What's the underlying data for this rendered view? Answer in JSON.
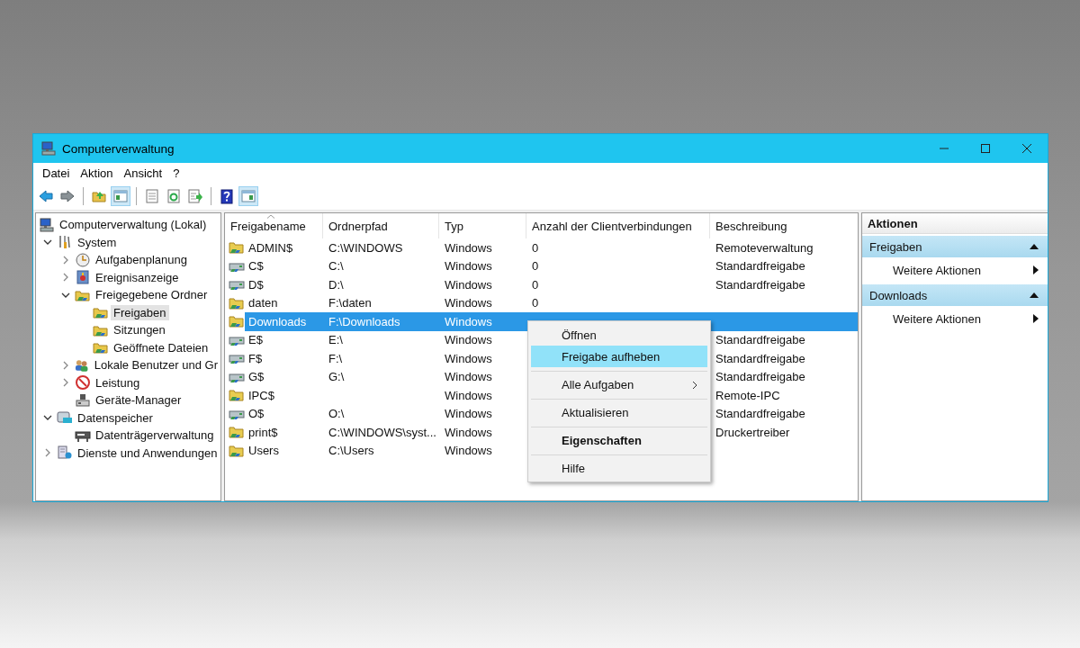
{
  "window": {
    "title": "Computerverwaltung"
  },
  "menu_bar": [
    "Datei",
    "Aktion",
    "Ansicht",
    "?"
  ],
  "toolbar": [
    {
      "kind": "back",
      "pressed": false
    },
    {
      "kind": "forward",
      "pressed": false
    },
    {
      "kind": "separator"
    },
    {
      "kind": "folder-up",
      "pressed": false
    },
    {
      "kind": "tree-pane",
      "pressed": true
    },
    {
      "kind": "separator"
    },
    {
      "kind": "properties",
      "pressed": false
    },
    {
      "kind": "refresh",
      "pressed": false
    },
    {
      "kind": "export",
      "pressed": false
    },
    {
      "kind": "separator"
    },
    {
      "kind": "help",
      "pressed": false
    },
    {
      "kind": "action-pane",
      "pressed": true
    }
  ],
  "tree": [
    {
      "label": "Computerverwaltung (Lokal)",
      "kind": "computer",
      "selected": false,
      "children": [
        {
          "label": "System",
          "kind": "tools",
          "expanded": true,
          "selected": false,
          "children": [
            {
              "label": "Aufgabenplanung",
              "kind": "clock",
              "expanded": false,
              "selected": false
            },
            {
              "label": "Ereignisanzeige",
              "kind": "event",
              "expanded": false,
              "selected": false
            },
            {
              "label": "Freigegebene Ordner",
              "kind": "share",
              "expanded": true,
              "selected": false,
              "children": [
                {
                  "label": "Freigaben",
                  "kind": "share",
                  "selected": true
                },
                {
                  "label": "Sitzungen",
                  "kind": "share",
                  "selected": false
                },
                {
                  "label": "Geöffnete Dateien",
                  "kind": "share",
                  "selected": false
                }
              ]
            },
            {
              "label": "Lokale Benutzer und Gr",
              "kind": "users",
              "expanded": false,
              "selected": false
            },
            {
              "label": "Leistung",
              "kind": "performance",
              "expanded": false,
              "selected": false
            },
            {
              "label": "Geräte-Manager",
              "kind": "device",
              "selected": false
            }
          ]
        },
        {
          "label": "Datenspeicher",
          "kind": "storage",
          "expanded": true,
          "selected": false,
          "children": [
            {
              "label": "Datenträgerverwaltung",
              "kind": "disk",
              "selected": false
            }
          ]
        },
        {
          "label": "Dienste und Anwendungen",
          "kind": "services",
          "expanded": false,
          "selected": false
        }
      ]
    }
  ],
  "table": {
    "columns": [
      {
        "label": "Freigabename",
        "sorted": true
      },
      {
        "label": "Ordnerpfad",
        "sorted": false
      },
      {
        "label": "Typ",
        "sorted": false
      },
      {
        "label": "Anzahl der Clientverbindungen",
        "sorted": false
      },
      {
        "label": "Beschreibung",
        "sorted": false
      }
    ],
    "rows": [
      {
        "kind": "folder",
        "selected": false,
        "name": "ADMIN$",
        "path": "C:\\WINDOWS",
        "type": "Windows",
        "connections": "0",
        "description": "Remoteverwaltung"
      },
      {
        "kind": "drive",
        "selected": false,
        "name": "C$",
        "path": "C:\\",
        "type": "Windows",
        "connections": "0",
        "description": "Standardfreigabe"
      },
      {
        "kind": "drive",
        "selected": false,
        "name": "D$",
        "path": "D:\\",
        "type": "Windows",
        "connections": "0",
        "description": "Standardfreigabe"
      },
      {
        "kind": "folder",
        "selected": false,
        "name": "daten",
        "path": "F:\\daten",
        "type": "Windows",
        "connections": "0"
      },
      {
        "kind": "folder",
        "selected": true,
        "name": "Downloads",
        "path": "F:\\Downloads",
        "type": "Windows"
      },
      {
        "kind": "drive",
        "selected": false,
        "name": "E$",
        "path": "E:\\",
        "type": "Windows",
        "description": "Standardfreigabe"
      },
      {
        "kind": "drive",
        "selected": false,
        "name": "F$",
        "path": "F:\\",
        "type": "Windows",
        "description": "Standardfreigabe"
      },
      {
        "kind": "drive",
        "selected": false,
        "name": "G$",
        "path": "G:\\",
        "type": "Windows",
        "description": "Standardfreigabe"
      },
      {
        "kind": "folder",
        "selected": false,
        "name": "IPC$",
        "type": "Windows",
        "description": "Remote-IPC"
      },
      {
        "kind": "drive",
        "selected": false,
        "name": "O$",
        "path": "O:\\",
        "type": "Windows",
        "description": "Standardfreigabe"
      },
      {
        "kind": "folder",
        "selected": false,
        "name": "print$",
        "path": "C:\\WINDOWS\\syst...",
        "type": "Windows",
        "description": "Druckertreiber"
      },
      {
        "kind": "folder",
        "selected": false,
        "name": "Users",
        "path": "C:\\Users",
        "type": "Windows"
      }
    ]
  },
  "context_menu": {
    "items": [
      {
        "label": "Öffnen",
        "selected": false,
        "separator_before": false,
        "submenu": false,
        "default": false
      },
      {
        "label": "Freigabe aufheben",
        "selected": true,
        "separator_before": false,
        "submenu": false,
        "default": false
      },
      {
        "label": "Alle Aufgaben",
        "selected": false,
        "separator_before": true,
        "submenu": true,
        "default": false
      },
      {
        "label": "Aktualisieren",
        "selected": false,
        "separator_before": true,
        "submenu": false,
        "default": false
      },
      {
        "label": "Eigenschaften",
        "selected": false,
        "separator_before": true,
        "submenu": false,
        "default": true
      },
      {
        "label": "Hilfe",
        "selected": false,
        "separator_before": true,
        "submenu": false,
        "default": false
      }
    ]
  },
  "actions": {
    "title": "Aktionen",
    "sections": [
      {
        "title": "Freigaben",
        "expanded": true,
        "items": [
          "Weitere Aktionen"
        ]
      },
      {
        "title": "Downloads",
        "expanded": true,
        "items": [
          "Weitere Aktionen"
        ]
      }
    ]
  }
}
